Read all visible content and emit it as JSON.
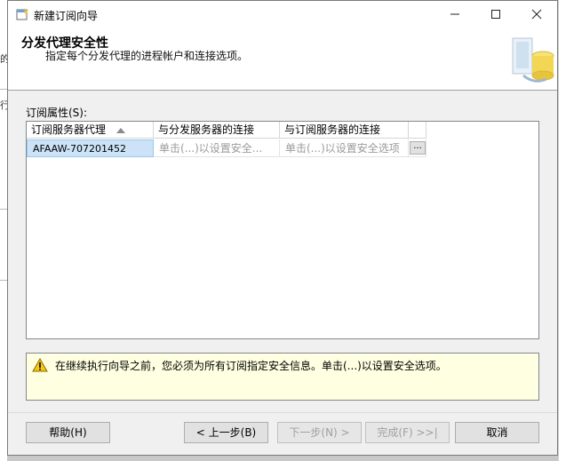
{
  "window": {
    "title": "新建订阅向导"
  },
  "header": {
    "title": "分发代理安全性",
    "subtitle": "指定每个分发代理的进程帐户和连接选项。"
  },
  "subscriptions": {
    "label": "订阅属性(S):",
    "columns": [
      "订阅服务器代理",
      "与分发服务器的连接",
      "与订阅服务器的连接"
    ],
    "rows": [
      {
        "agent": "AFAAW-707201452",
        "distributor_conn": "单击(...)以设置安全...",
        "subscriber_conn": "单击(...)以设置安全选项",
        "button": "..."
      }
    ]
  },
  "warning": {
    "text": "在继续执行向导之前，您必须为所有订阅指定安全信息。单击(...)以设置安全选项。"
  },
  "buttons": {
    "help": "帮助(H)",
    "back": "< 上一步(B)",
    "next": "下一步(N) >",
    "finish": "完成(F) >>|",
    "cancel": "取消"
  },
  "background_marks": [
    "的",
    "行"
  ],
  "colors": {
    "selected_row": "#cce3f7",
    "warning_bg": "#ffffe1"
  }
}
